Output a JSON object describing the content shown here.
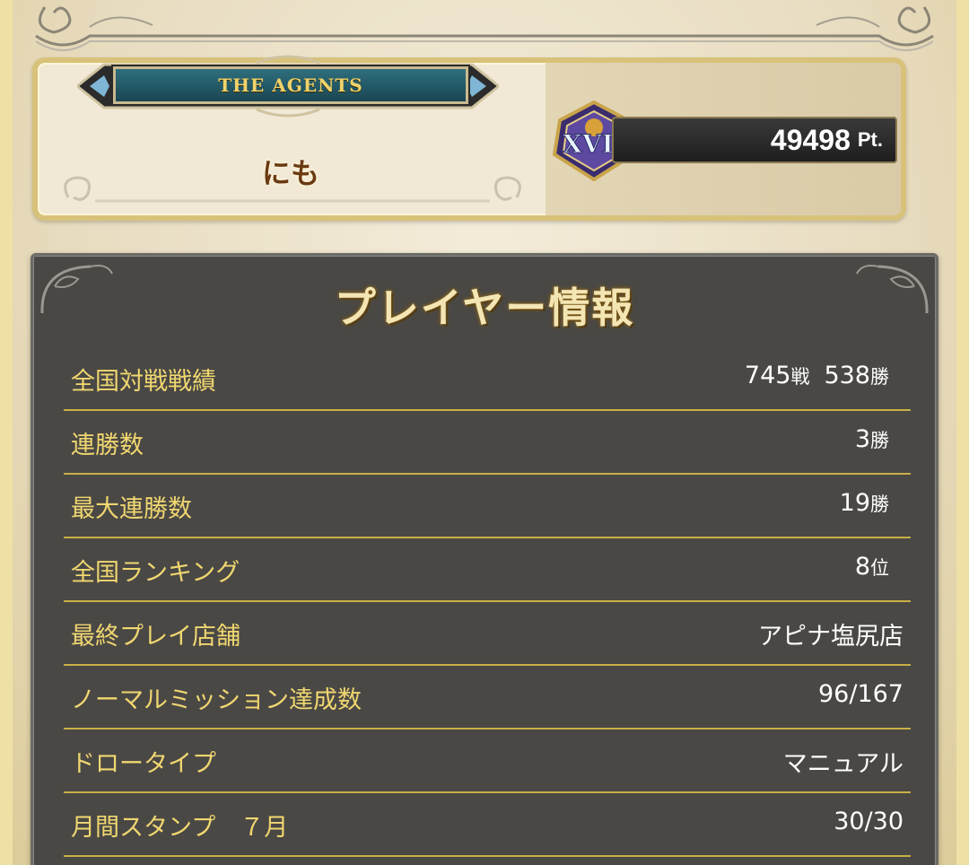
{
  "profile": {
    "team_name": "THE AGENTS",
    "player_name": "にも",
    "rank_numeral": "XVII",
    "score": "49498",
    "score_unit": "Pt."
  },
  "panel": {
    "title": "プレイヤー情報"
  },
  "rows": {
    "national_record": {
      "label": "全国対戦戦績",
      "battles": "745",
      "battles_unit": "戦",
      "wins": "538",
      "wins_unit": "勝"
    },
    "win_streak": {
      "label": "連勝数",
      "value": "3",
      "unit": "勝"
    },
    "max_win_streak": {
      "label": "最大連勝数",
      "value": "19",
      "unit": "勝"
    },
    "national_ranking": {
      "label": "全国ランキング",
      "value": "8",
      "unit": "位"
    },
    "last_store": {
      "label": "最終プレイ店舗",
      "value": "アピナ塩尻店"
    },
    "normal_missions": {
      "label": "ノーマルミッション達成数",
      "value": "96/167"
    },
    "draw_type": {
      "label": "ドロータイプ",
      "value": "マニュアル"
    },
    "monthly_stamp": {
      "label": "月間スタンプ　７月",
      "value": "30/30"
    }
  },
  "colors": {
    "panel_bg": "#4a4845",
    "label_gold": "#f0d770",
    "divider_gold": "#c8b046",
    "name_brown": "#6b3a12"
  }
}
